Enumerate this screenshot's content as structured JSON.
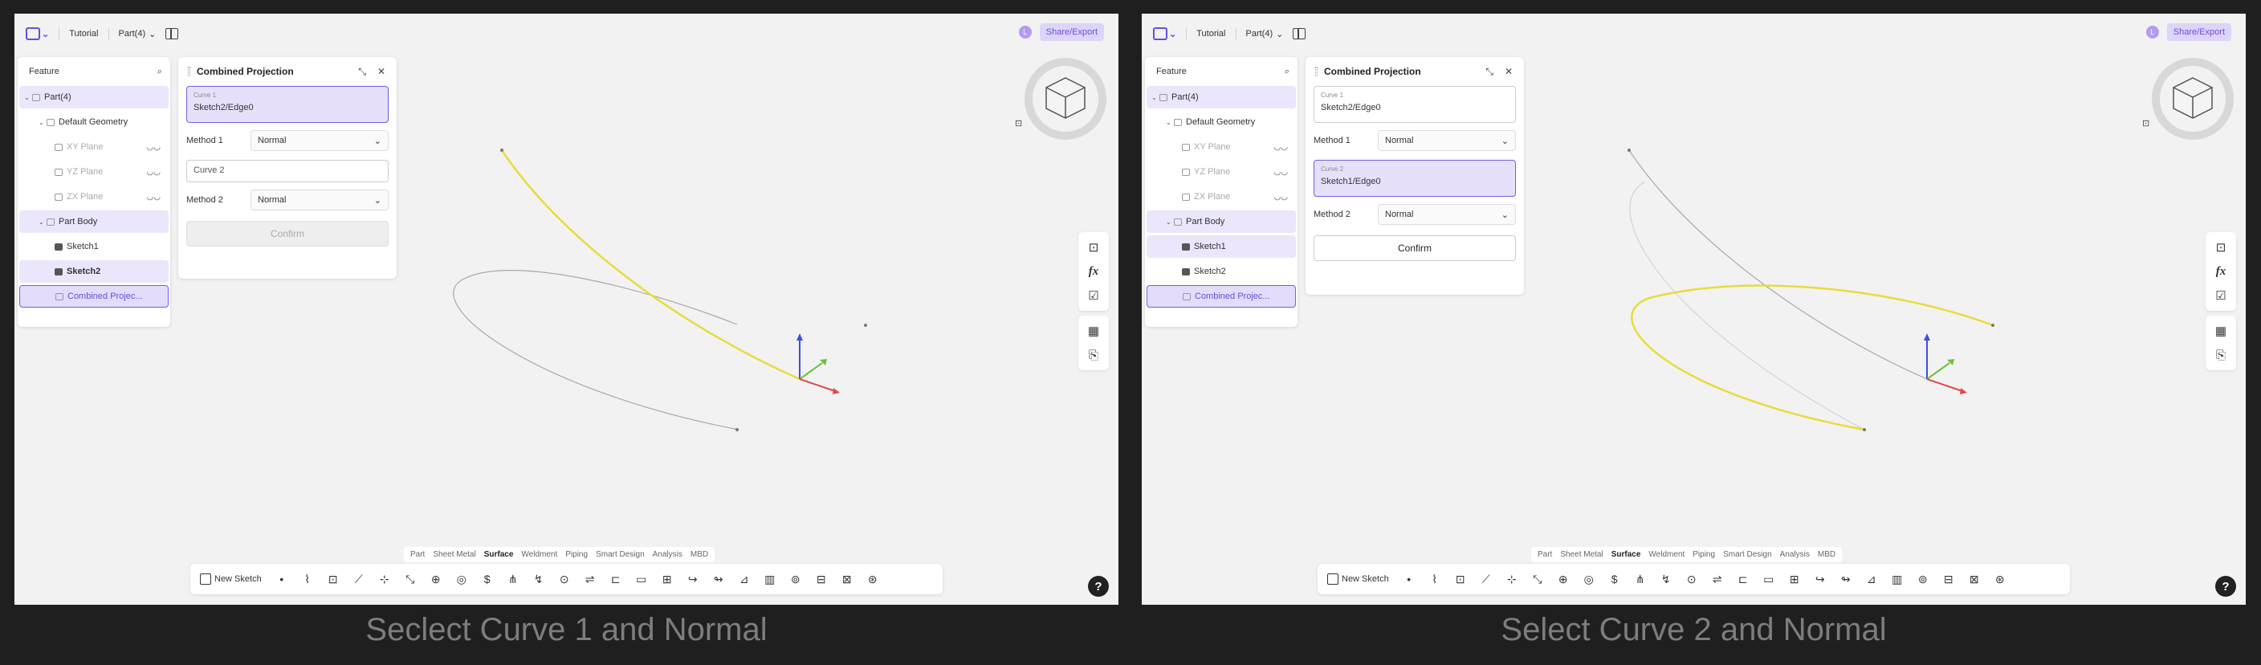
{
  "captions": {
    "left": "Seclect Curve 1 and Normal",
    "right": "Select Curve 2 and Normal"
  },
  "topbar": {
    "tutorial": "Tutorial",
    "part": "Part(4)",
    "chev": "⌄",
    "share": "Share/Export",
    "avatar": "L"
  },
  "feature": {
    "title": "Feature",
    "items": [
      {
        "label": "Part(4)"
      },
      {
        "label": "Default Geometry"
      },
      {
        "label": "XY Plane"
      },
      {
        "label": "YZ Plane"
      },
      {
        "label": "ZX Plane"
      },
      {
        "label": "Part Body"
      },
      {
        "label": "Sketch1"
      },
      {
        "label": "Sketch2"
      },
      {
        "label": "Combined Projec..."
      }
    ],
    "eye": "◡◡"
  },
  "panel": {
    "title": "Combined Projection",
    "curve1_label": "Curve 1",
    "curve2_label": "Curve 2",
    "method1_label": "Method 1",
    "method2_label": "Method 2",
    "method_value": "Normal",
    "confirm": "Confirm",
    "curve2_placeholder": "Curve 2"
  },
  "left": {
    "curve1_value": "Sketch2/Edge0"
  },
  "right": {
    "curve1_value": "Sketch2/Edge0",
    "curve2_value": "Sketch1/Edge0"
  },
  "tabs": [
    "Part",
    "Sheet Metal",
    "Surface",
    "Weldment",
    "Piping",
    "Smart Design",
    "Analysis",
    "MBD"
  ],
  "active_tab": "Surface",
  "toolbar": {
    "new_sketch": "New Sketch",
    "icons": [
      "•",
      "⌇",
      "⊡",
      "⟋",
      "⊹",
      "⤡",
      "⊕",
      "◎",
      "$",
      "⋔",
      "↯",
      "⊙",
      "⇌",
      "⊏",
      "▭",
      "⊞",
      "↪",
      "↬",
      "⊿",
      "▥",
      "⊚",
      "⊟",
      "⊠",
      "⊛"
    ]
  },
  "right_tools": [
    "⊡",
    "fx",
    "☑",
    "▦",
    "⎘"
  ],
  "help": "?",
  "colors": {
    "accent": "#6b4bdb",
    "selected_curve": "#e8dc3c",
    "curve": "#a8a8a8"
  }
}
